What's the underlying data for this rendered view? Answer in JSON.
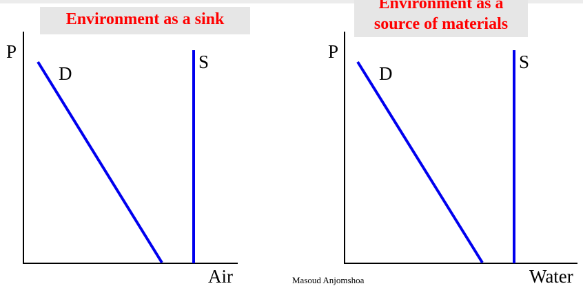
{
  "left_panel": {
    "title": "Environment as a sink",
    "y_axis_label": "P",
    "x_axis_label": "Air",
    "demand_label": "D",
    "supply_label": "S"
  },
  "right_panel": {
    "title_line1": "Environment as a",
    "title_line2": "source of materials",
    "y_axis_label": "P",
    "x_axis_label": "Water",
    "demand_label": "D",
    "supply_label": "S"
  },
  "footer": {
    "credit": "Masoud Anjomshoa"
  },
  "colors": {
    "title_text": "#ff0000",
    "title_background": "#e6e6e6",
    "curve": "#0000ee",
    "axis": "#000000"
  }
}
